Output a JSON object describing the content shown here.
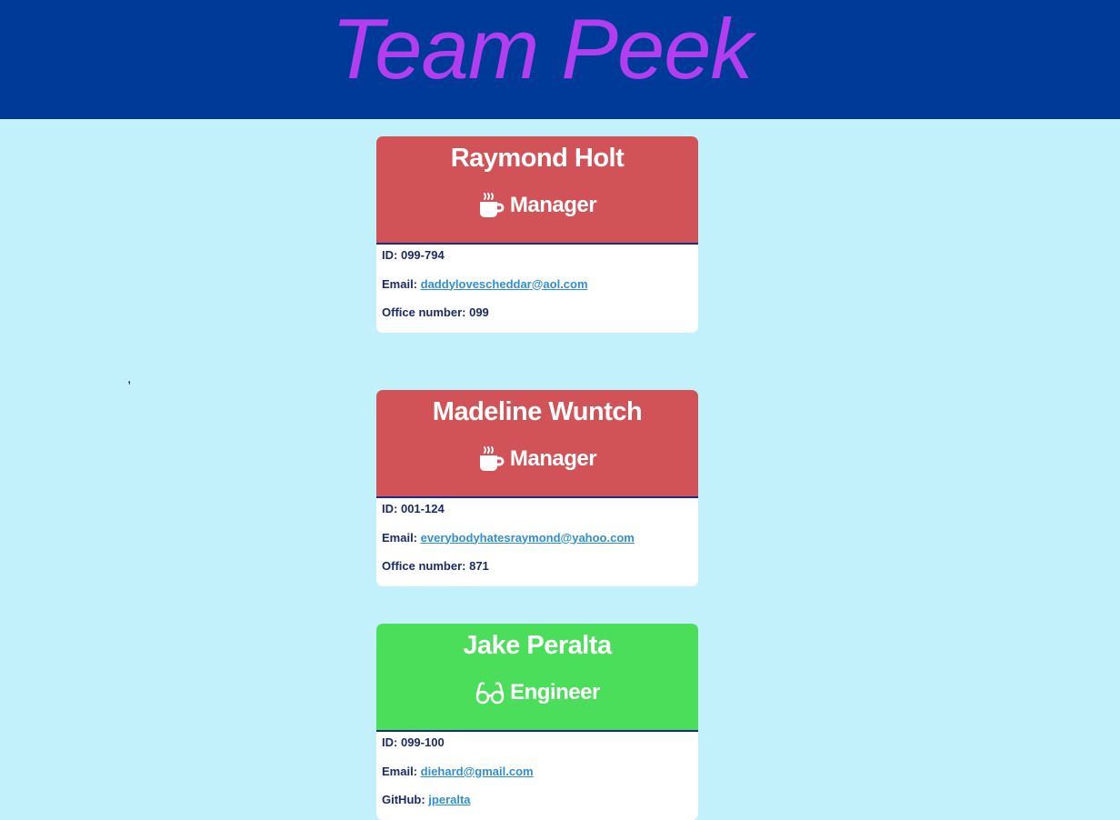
{
  "header": {
    "title": "Team Peek"
  },
  "separator": ",",
  "employees": [
    {
      "name": "Raymond Holt",
      "role": "Manager",
      "role_icon": "coffee-mug-icon",
      "id_label": "ID:",
      "id": "099-794",
      "email_label": "Email:",
      "email": "daddylovescheddar@aol.com",
      "extra_label": "Office number:",
      "extra_value": "099"
    },
    {
      "name": "Madeline Wuntch",
      "role": "Manager",
      "role_icon": "coffee-mug-icon",
      "id_label": "ID:",
      "id": "001-124",
      "email_label": "Email:",
      "email": "everybodyhatesraymond@yahoo.com",
      "extra_label": "Office number:",
      "extra_value": "871"
    },
    {
      "name": "Jake Peralta",
      "role": "Engineer",
      "role_icon": "glasses-icon",
      "id_label": "ID:",
      "id": "099-100",
      "email_label": "Email:",
      "email": "diehard@gmail.com",
      "extra_label": "GitHub:",
      "extra_value": "jperalta"
    }
  ],
  "colors": {
    "header_bg": "#003a99",
    "title": "#b23ef0",
    "page_bg": "#c2f0fb",
    "manager": "#d15257",
    "engineer": "#4ade5a",
    "link": "#2f8fd6"
  }
}
